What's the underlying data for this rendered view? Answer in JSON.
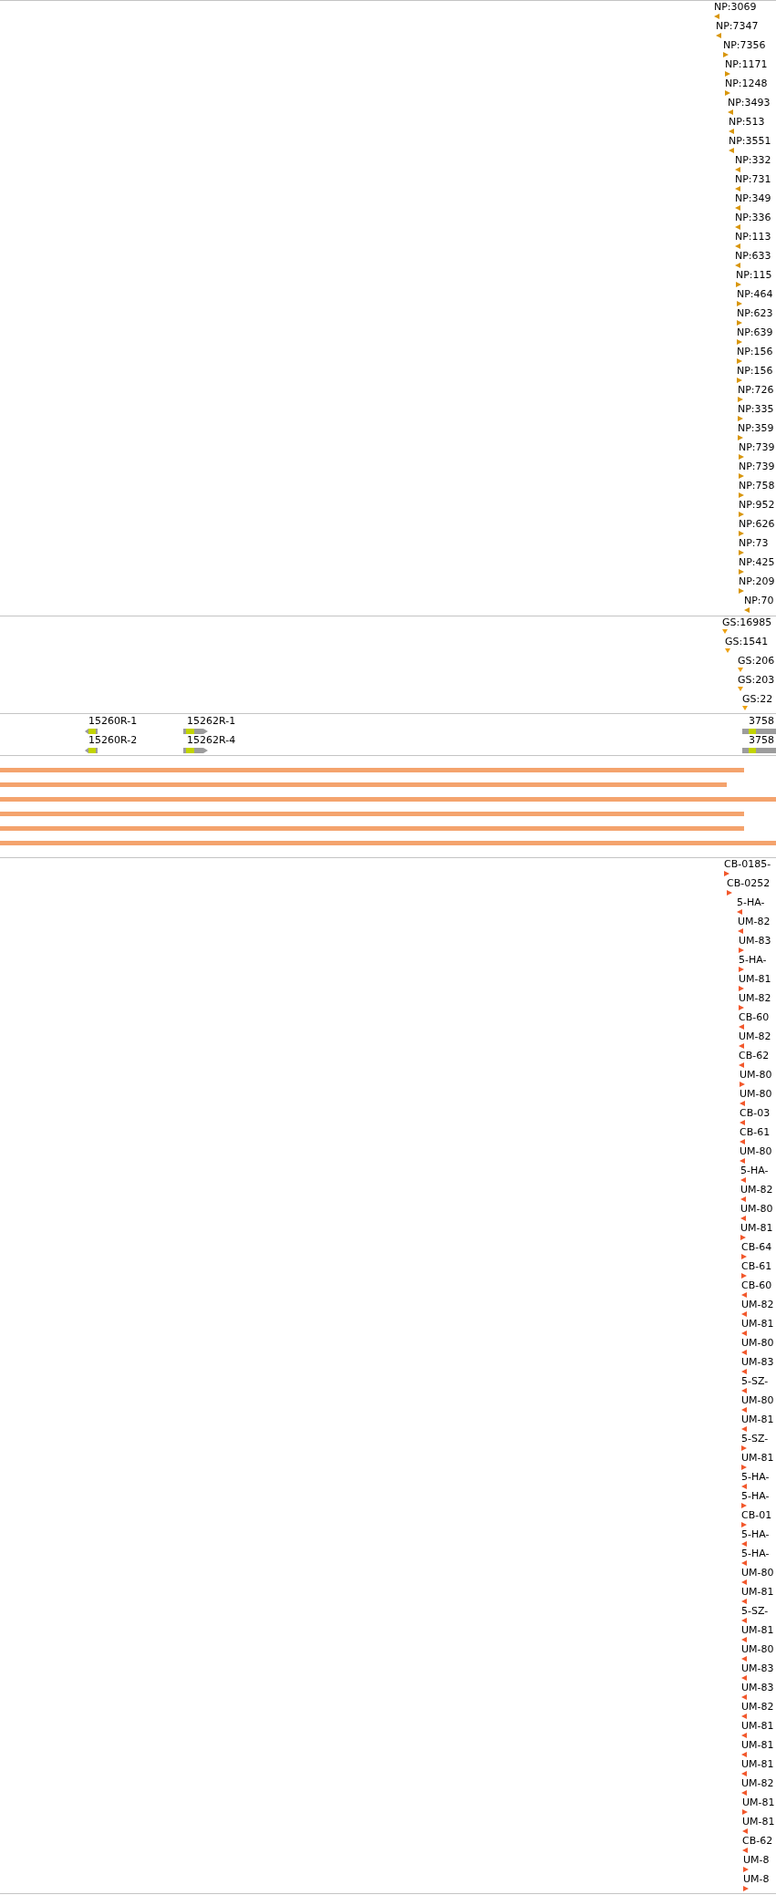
{
  "tracks": [
    {
      "kind": "marks",
      "color": "#d8960c",
      "features": [
        {
          "label": "NP:3069",
          "reverse": true
        },
        {
          "label": "NP:7347",
          "reverse": true
        },
        {
          "label": "NP:7356",
          "reverse": false
        },
        {
          "label": "NP:1171",
          "reverse": false
        },
        {
          "label": "NP:1248",
          "reverse": false
        },
        {
          "label": "NP:3493",
          "reverse": true
        },
        {
          "label": "NP:513",
          "reverse": true
        },
        {
          "label": "NP:3551",
          "reverse": true
        },
        {
          "label": "NP:332",
          "reverse": true
        },
        {
          "label": "NP:731",
          "reverse": true
        },
        {
          "label": "NP:349",
          "reverse": true
        },
        {
          "label": "NP:336",
          "reverse": true
        },
        {
          "label": "NP:113",
          "reverse": true
        },
        {
          "label": "NP:633",
          "reverse": true
        },
        {
          "label": "NP:115",
          "reverse": false
        },
        {
          "label": "NP:464",
          "reverse": false
        },
        {
          "label": "NP:623",
          "reverse": false
        },
        {
          "label": "NP:639",
          "reverse": false
        },
        {
          "label": "NP:156",
          "reverse": false
        },
        {
          "label": "NP:156",
          "reverse": false
        },
        {
          "label": "NP:726",
          "reverse": false
        },
        {
          "label": "NP:335",
          "reverse": false
        },
        {
          "label": "NP:359",
          "reverse": false
        },
        {
          "label": "NP:739",
          "reverse": false
        },
        {
          "label": "NP:739",
          "reverse": false
        },
        {
          "label": "NP:758",
          "reverse": false
        },
        {
          "label": "NP:952",
          "reverse": false
        },
        {
          "label": "NP:626",
          "reverse": false
        },
        {
          "label": "NP:73",
          "reverse": false
        },
        {
          "label": "NP:425",
          "reverse": false
        },
        {
          "label": "NP:209",
          "reverse": false
        },
        {
          "label": "NP:70",
          "reverse": true
        }
      ]
    },
    {
      "kind": "drops",
      "color": "#eea212",
      "features": [
        {
          "label": "GS:16985"
        },
        {
          "label": "GS:1541"
        },
        {
          "label": "GS:206"
        },
        {
          "label": "GS:203"
        },
        {
          "label": "GS:22"
        }
      ]
    },
    {
      "kind": "genes",
      "rows": [
        [
          {
            "label": "15260R-1",
            "reverse": true
          },
          {
            "label": "15262R-1",
            "reverse": false
          },
          {
            "label": "3758"
          }
        ],
        [
          {
            "label": "15260R-2",
            "reverse": true
          },
          {
            "label": "15262R-4",
            "reverse": false
          },
          {
            "label": "3758"
          }
        ]
      ]
    },
    {
      "kind": "reads"
    },
    {
      "kind": "marks",
      "color": "#f2582c",
      "features": [
        {
          "label": "CB-0185-",
          "reverse": false
        },
        {
          "label": "CB-0252",
          "reverse": false
        },
        {
          "label": "5-HA-",
          "reverse": true
        },
        {
          "label": "UM-82",
          "reverse": true
        },
        {
          "label": "UM-83",
          "reverse": false
        },
        {
          "label": "5-HA-",
          "reverse": false
        },
        {
          "label": "UM-81",
          "reverse": false
        },
        {
          "label": "UM-82",
          "reverse": false
        },
        {
          "label": "CB-60",
          "reverse": true
        },
        {
          "label": "UM-82",
          "reverse": true
        },
        {
          "label": "CB-62",
          "reverse": true
        },
        {
          "label": "UM-80",
          "reverse": false
        },
        {
          "label": "UM-80",
          "reverse": true
        },
        {
          "label": "CB-03",
          "reverse": true
        },
        {
          "label": "CB-61",
          "reverse": true
        },
        {
          "label": "UM-80",
          "reverse": true
        },
        {
          "label": "5-HA-",
          "reverse": true
        },
        {
          "label": "UM-82",
          "reverse": true
        },
        {
          "label": "UM-80",
          "reverse": true
        },
        {
          "label": "UM-81",
          "reverse": false
        },
        {
          "label": "CB-64",
          "reverse": false
        },
        {
          "label": "CB-61",
          "reverse": false
        },
        {
          "label": "CB-60",
          "reverse": true
        },
        {
          "label": "UM-82",
          "reverse": true
        },
        {
          "label": "UM-81",
          "reverse": true
        },
        {
          "label": "UM-80",
          "reverse": true
        },
        {
          "label": "UM-83",
          "reverse": true
        },
        {
          "label": "5-SZ-",
          "reverse": true
        },
        {
          "label": "UM-80",
          "reverse": true
        },
        {
          "label": "UM-81",
          "reverse": true
        },
        {
          "label": "5-SZ-",
          "reverse": false
        },
        {
          "label": "UM-81",
          "reverse": false
        },
        {
          "label": "5-HA-",
          "reverse": true
        },
        {
          "label": "5-HA-",
          "reverse": false
        },
        {
          "label": "CB-01",
          "reverse": false
        },
        {
          "label": "5-HA-",
          "reverse": true
        },
        {
          "label": "5-HA-",
          "reverse": true
        },
        {
          "label": "UM-80",
          "reverse": true
        },
        {
          "label": "UM-81",
          "reverse": true
        },
        {
          "label": "5-SZ-",
          "reverse": true
        },
        {
          "label": "UM-81",
          "reverse": true
        },
        {
          "label": "UM-80",
          "reverse": true
        },
        {
          "label": "UM-83",
          "reverse": true
        },
        {
          "label": "UM-83",
          "reverse": true
        },
        {
          "label": "UM-82",
          "reverse": true
        },
        {
          "label": "UM-81",
          "reverse": true
        },
        {
          "label": "UM-81",
          "reverse": true
        },
        {
          "label": "UM-81",
          "reverse": true
        },
        {
          "label": "UM-82",
          "reverse": true
        },
        {
          "label": "UM-81",
          "reverse": false
        },
        {
          "label": "UM-81",
          "reverse": true
        },
        {
          "label": "CB-62",
          "reverse": true
        },
        {
          "label": "UM-8",
          "reverse": false
        },
        {
          "label": "UM-8",
          "reverse": false
        }
      ]
    }
  ]
}
